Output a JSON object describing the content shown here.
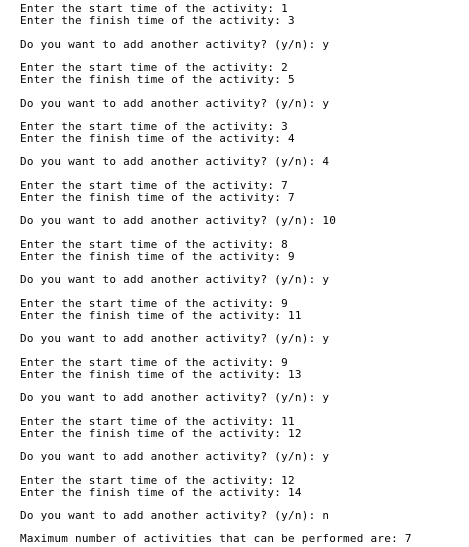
{
  "console": {
    "lines": [
      "Enter the start time of the activity: 1",
      "Enter the finish time of the activity: 3",
      "Do you want to add another activity? (y/n): y",
      "Enter the start time of the activity: 2",
      "Enter the finish time of the activity: 5",
      "Do you want to add another activity? (y/n): y",
      "Enter the start time of the activity: 3",
      "Enter the finish time of the activity: 4",
      "Do you want to add another activity? (y/n): 4",
      "Enter the start time of the activity: 7",
      "Enter the finish time of the activity: 7",
      "Do you want to add another activity? (y/n): 10",
      "Enter the start time of the activity: 8",
      "Enter the finish time of the activity: 9",
      "Do you want to add another activity? (y/n): y",
      "Enter the start time of the activity: 9",
      "Enter the finish time of the activity: 11",
      "Do you want to add another activity? (y/n): y",
      "Enter the start time of the activity: 9",
      "Enter the finish time of the activity: 13",
      "Do you want to add another activity? (y/n): y",
      "Enter the start time of the activity: 11",
      "Enter the finish time of the activity: 12",
      "Do you want to add another activity? (y/n): y",
      "Enter the start time of the activity: 12",
      "Enter the finish time of the activity: 14",
      "Do you want to add another activity? (y/n): n",
      "Maximum number of activities that can be performed are: 7"
    ]
  }
}
